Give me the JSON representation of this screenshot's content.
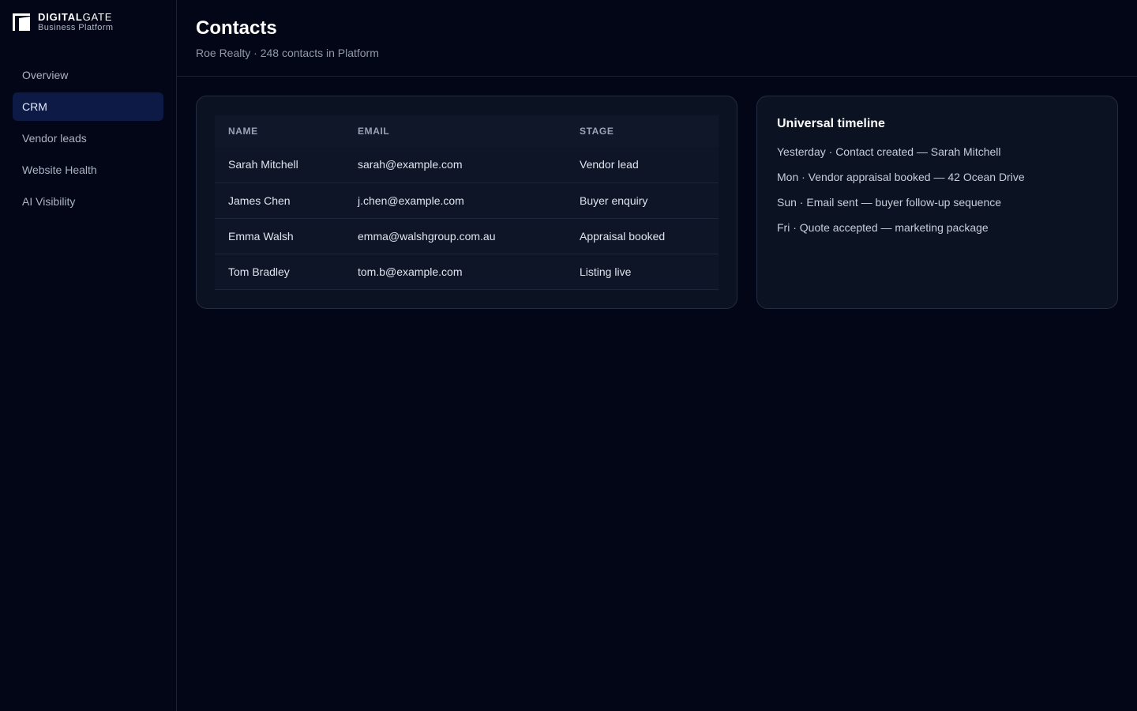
{
  "brand": {
    "name_bold": "DIGITAL",
    "name_light": "GATE",
    "subtitle": "Business Platform"
  },
  "sidebar": {
    "items": [
      {
        "label": "Overview",
        "active": false
      },
      {
        "label": "CRM",
        "active": true
      },
      {
        "label": "Vendor leads",
        "active": false
      },
      {
        "label": "Website Health",
        "active": false
      },
      {
        "label": "AI Visibility",
        "active": false
      }
    ]
  },
  "header": {
    "title": "Contacts",
    "subtitle": "Roe Realty · 248 contacts in Platform"
  },
  "contacts": {
    "columns": [
      "NAME",
      "EMAIL",
      "STAGE"
    ],
    "rows": [
      {
        "name": "Sarah Mitchell",
        "email": "sarah@example.com",
        "stage": "Vendor lead"
      },
      {
        "name": "James Chen",
        "email": "j.chen@example.com",
        "stage": "Buyer enquiry"
      },
      {
        "name": "Emma Walsh",
        "email": "emma@walshgroup.com.au",
        "stage": "Appraisal booked"
      },
      {
        "name": "Tom Bradley",
        "email": "tom.b@example.com",
        "stage": "Listing live"
      }
    ]
  },
  "timeline": {
    "title": "Universal timeline",
    "items": [
      "Yesterday · Contact created — Sarah Mitchell",
      "Mon · Vendor appraisal booked — 42 Ocean Drive",
      "Sun · Email sent — buyer follow-up sequence",
      "Fri · Quote accepted — marketing package"
    ]
  },
  "colors": {
    "background": "#030617",
    "active_nav": "#0c1a45",
    "card": "#0b1222",
    "border": "#232c40"
  }
}
